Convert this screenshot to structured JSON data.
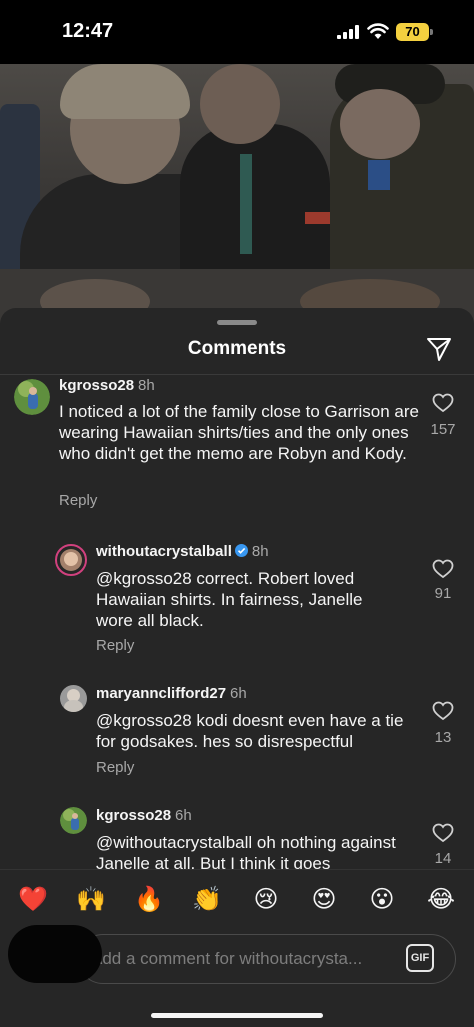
{
  "status_bar": {
    "time": "12:47",
    "battery": "70"
  },
  "sheet": {
    "title": "Comments"
  },
  "comments": [
    {
      "username": "kgrosso28",
      "time": "8h",
      "text": "I noticed a lot of the family close to Garrison are wearing Hawaiian shirts/ties and the only ones who didn't get the memo are Robyn and Kody.",
      "reply": "Reply",
      "likes": "157"
    },
    {
      "username": "withoutacrystalball",
      "time": "8h",
      "verified": true,
      "text": "@kgrosso28 correct. Robert loved Hawaiian shirts. In fairness, Janelle wore all black.",
      "reply": "Reply",
      "likes": "91"
    },
    {
      "username": "maryannclifford27",
      "time": "6h",
      "text": "@kgrosso28 kodi doesnt even have a tie for godsakes. hes so disrespectful",
      "reply": "Reply",
      "likes": "13"
    },
    {
      "username": "kgrosso28",
      "time": "6h",
      "text": "@withoutacrystalball oh nothing against Janelle at all. But I think it goes",
      "likes": "14"
    }
  ],
  "reactions": [
    "❤️",
    "🙌",
    "🔥",
    "👏",
    "😢",
    "😍",
    "😮",
    "😂"
  ],
  "input": {
    "placeholder": "Add a comment for withoutacrysta...",
    "gif_label": "GIF"
  },
  "colors": {
    "sheet_bg": "#262626",
    "verified": "#3897f0",
    "battery": "#f4d03f"
  }
}
